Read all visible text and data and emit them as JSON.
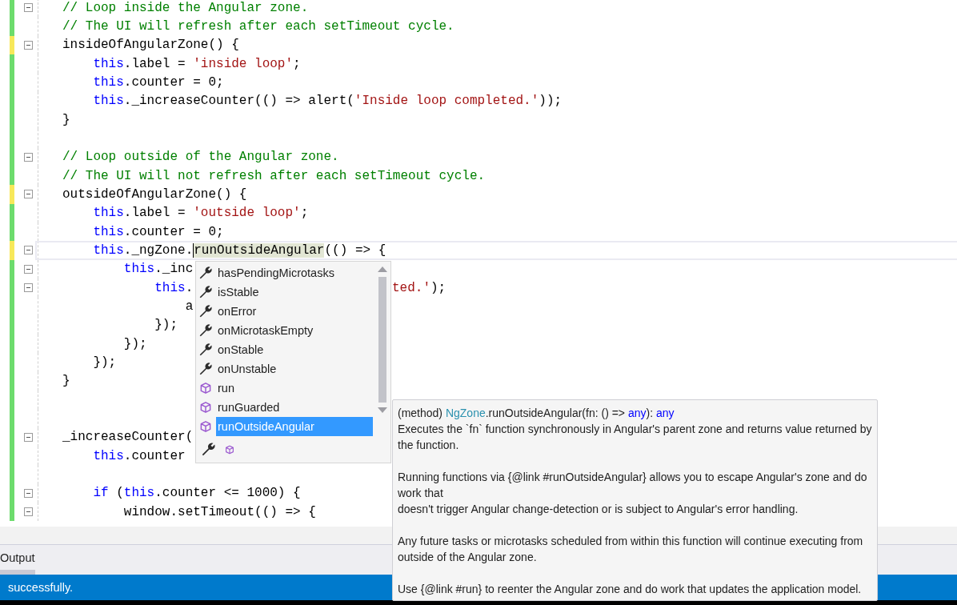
{
  "editor": {
    "lines": [
      {
        "color": "#6ddc6d",
        "fold": true,
        "current": false,
        "tokens": [
          {
            "kind": "comment",
            "text": "// Loop inside the Angular zone."
          }
        ]
      },
      {
        "color": "#6ddc6d",
        "fold": false,
        "current": false,
        "tokens": [
          {
            "kind": "comment",
            "text": "// The UI will refresh after each setTimeout cycle."
          }
        ]
      },
      {
        "color": "#f7e85a",
        "fold": true,
        "current": false,
        "tokens": [
          {
            "kind": "plain",
            "text": "insideOfAngularZone() {"
          }
        ]
      },
      {
        "color": "#6ddc6d",
        "fold": false,
        "current": false,
        "tokens": [
          {
            "kind": "keyword",
            "text": "    this"
          },
          {
            "kind": "plain",
            "text": ".label = "
          },
          {
            "kind": "string",
            "text": "'inside loop'"
          },
          {
            "kind": "plain",
            "text": ";"
          }
        ]
      },
      {
        "color": "#6ddc6d",
        "fold": false,
        "current": false,
        "tokens": [
          {
            "kind": "keyword",
            "text": "    this"
          },
          {
            "kind": "plain",
            "text": ".counter = 0;"
          }
        ]
      },
      {
        "color": "#6ddc6d",
        "fold": false,
        "current": false,
        "tokens": [
          {
            "kind": "keyword",
            "text": "    this"
          },
          {
            "kind": "plain",
            "text": "._increaseCounter(() => alert("
          },
          {
            "kind": "string",
            "text": "'Inside loop completed.'"
          },
          {
            "kind": "plain",
            "text": "));"
          }
        ]
      },
      {
        "color": "#6ddc6d",
        "fold": false,
        "current": false,
        "tokens": [
          {
            "kind": "plain",
            "text": "}"
          }
        ]
      },
      {
        "color": "#6ddc6d",
        "fold": false,
        "current": false
      },
      {
        "color": "#6ddc6d",
        "fold": true,
        "current": false,
        "tokens": [
          {
            "kind": "comment",
            "text": "// Loop outside of the Angular zone."
          }
        ]
      },
      {
        "color": "#6ddc6d",
        "fold": false,
        "current": false,
        "tokens": [
          {
            "kind": "comment",
            "text": "// The UI will not refresh after each setTimeout cycle."
          }
        ]
      },
      {
        "color": "#f7e85a",
        "fold": true,
        "current": false,
        "tokens": [
          {
            "kind": "plain",
            "text": "outsideOfAngularZone() {"
          }
        ]
      },
      {
        "color": "#6ddc6d",
        "fold": false,
        "current": false,
        "tokens": [
          {
            "kind": "keyword",
            "text": "    this"
          },
          {
            "kind": "plain",
            "text": ".label = "
          },
          {
            "kind": "string",
            "text": "'outside loop'"
          },
          {
            "kind": "plain",
            "text": ";"
          }
        ]
      },
      {
        "color": "#6ddc6d",
        "fold": false,
        "current": false,
        "tokens": [
          {
            "kind": "keyword",
            "text": "    this"
          },
          {
            "kind": "plain",
            "text": ".counter = 0;"
          }
        ]
      },
      {
        "color": "#f7e85a",
        "fold": true,
        "current": true,
        "tokens": [
          {
            "kind": "keyword",
            "text": "    this"
          },
          {
            "kind": "plain",
            "text": "._ngZone."
          },
          {
            "kind": "match",
            "text": "runOutsideAngular"
          },
          {
            "kind": "plain",
            "text": "(() => {"
          }
        ]
      },
      {
        "color": "#6ddc6d",
        "fold": true,
        "current": false,
        "tokens": [
          {
            "kind": "keyword",
            "text": "        this"
          },
          {
            "kind": "plain",
            "text": "._inc"
          }
        ]
      },
      {
        "color": "#6ddc6d",
        "fold": true,
        "current": false,
        "tokens": [
          {
            "kind": "keyword",
            "text": "            this"
          },
          {
            "kind": "plain",
            "text": "."
          }
        ],
        "tail": [
          {
            "kind": "string",
            "text": "ted.'"
          },
          {
            "kind": "plain",
            "text": ");"
          }
        ]
      },
      {
        "color": "#6ddc6d",
        "fold": false,
        "current": false,
        "tokens": [
          {
            "kind": "plain",
            "text": "                a"
          }
        ]
      },
      {
        "color": "#6ddc6d",
        "fold": false,
        "current": false,
        "tokens": [
          {
            "kind": "plain",
            "text": "            });"
          }
        ]
      },
      {
        "color": "#6ddc6d",
        "fold": false,
        "current": false,
        "tokens": [
          {
            "kind": "plain",
            "text": "        });"
          }
        ]
      },
      {
        "color": "#6ddc6d",
        "fold": false,
        "current": false,
        "tokens": [
          {
            "kind": "plain",
            "text": "    });"
          }
        ]
      },
      {
        "color": "#6ddc6d",
        "fold": false,
        "current": false,
        "tokens": [
          {
            "kind": "plain",
            "text": "}"
          }
        ]
      },
      {
        "color": "#6ddc6d",
        "fold": false,
        "current": false
      },
      {
        "color": "#6ddc6d",
        "fold": false,
        "current": false
      },
      {
        "color": "#6ddc6d",
        "fold": true,
        "current": false,
        "tokens": [
          {
            "kind": "plain",
            "text": "_increaseCounter("
          }
        ]
      },
      {
        "color": "#6ddc6d",
        "fold": false,
        "current": false,
        "tokens": [
          {
            "kind": "keyword",
            "text": "    this"
          },
          {
            "kind": "plain",
            "text": ".counter"
          }
        ]
      },
      {
        "color": "#6ddc6d",
        "fold": false,
        "current": false
      },
      {
        "color": "#6ddc6d",
        "fold": true,
        "current": false,
        "tokens": [
          {
            "kind": "keyword",
            "text": "    if"
          },
          {
            "kind": "plain",
            "text": " ("
          },
          {
            "kind": "keyword",
            "text": "this"
          },
          {
            "kind": "plain",
            "text": ".counter <= 1000) {"
          }
        ]
      },
      {
        "color": "#6ddc6d",
        "fold": true,
        "current": false,
        "tokens": [
          {
            "kind": "plain",
            "text": "        window.setTimeout(() => {"
          }
        ]
      }
    ]
  },
  "completion": {
    "items": [
      {
        "label": "hasPendingMicrotasks",
        "kind": "property",
        "selected": false
      },
      {
        "label": "isStable",
        "kind": "property",
        "selected": false
      },
      {
        "label": "onError",
        "kind": "property",
        "selected": false
      },
      {
        "label": "onMicrotaskEmpty",
        "kind": "property",
        "selected": false
      },
      {
        "label": "onStable",
        "kind": "property",
        "selected": false
      },
      {
        "label": "onUnstable",
        "kind": "property",
        "selected": false
      },
      {
        "label": "run",
        "kind": "method",
        "selected": false
      },
      {
        "label": "runGuarded",
        "kind": "method",
        "selected": false
      },
      {
        "label": "runOutsideAngular",
        "kind": "method",
        "selected": true
      }
    ]
  },
  "tooltip": {
    "signature": [
      {
        "kind": "plain",
        "text": "(method) "
      },
      {
        "kind": "type",
        "text": "NgZone"
      },
      {
        "kind": "plain",
        "text": ".runOutsideAngular(fn: () => "
      },
      {
        "kind": "keyword",
        "text": "any"
      },
      {
        "kind": "plain",
        "text": "): "
      },
      {
        "kind": "keyword",
        "text": "any"
      }
    ],
    "paragraphs": [
      [
        "Executes the `fn` function synchronously in Angular's parent zone and returns value returned by",
        "the function."
      ],
      [
        "Running functions via {@link #runOutsideAngular} allows you to escape Angular's zone and do",
        "work that",
        "doesn't trigger Angular change-detection or is subject to Angular's error handling."
      ],
      [
        "Any future tasks or microtasks scheduled from within this function will continue executing from",
        "outside of the Angular zone."
      ],
      [
        "Use {@link #run} to reenter the Angular zone and do work that updates the application model."
      ]
    ]
  },
  "panel": {
    "tabs": [
      {
        "label": "Output",
        "selected": true
      }
    ]
  },
  "status_bar": {
    "text": "successfully."
  }
}
